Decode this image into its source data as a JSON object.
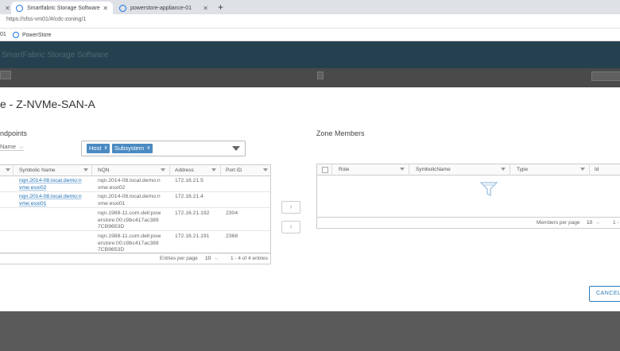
{
  "browser": {
    "tabs": [
      {
        "label": "Smartfabric Storage Software"
      },
      {
        "label": "powerstore-appliance-01"
      }
    ],
    "url": "https://sfss-vm01/#/cdc-zoning/1",
    "bookmark_prefix": "01",
    "bookmark": "PowerStore"
  },
  "app": {
    "title": "SmartFabric Storage Software"
  },
  "modal": {
    "title": "e - Z-NVMe-SAN-A",
    "endpoints_label": "ndpoints",
    "filter_name": "Name",
    "filter_chips": [
      "Host",
      "Subsystem"
    ],
    "zone_members_label": "Zone Members",
    "cancel_label": "CANCEL"
  },
  "endpoints_table": {
    "columns": [
      "Symbolic Name",
      "NQN",
      "Address",
      "Port ID"
    ],
    "rows": [
      {
        "symbolic_name": "nqn.2014-08.local.demo:n vme:esxi02",
        "nqn": "nqn.2014-08.local.demo:n vme:esxi02",
        "address": "172.16.21.5",
        "port_id": ""
      },
      {
        "symbolic_name": "nqn.2014-08.local.demo:n vme:esxi01",
        "nqn": "nqn.2014-08.local.demo:n vme:esxi01",
        "address": "172.16.21.4",
        "port_id": ""
      },
      {
        "symbolic_name": "",
        "nqn": "nqn.1988-11.com.dell:pow erstore:00:c9bc417ac389 7CB9653D",
        "address": "172.16.21.192",
        "port_id": "2304"
      },
      {
        "symbolic_name": "",
        "nqn": "nqn.1988-11.com.dell:pow erstore:00:c9bc417ac389 7CB9653D",
        "address": "172.16.21.191",
        "port_id": "2368"
      }
    ],
    "footer": {
      "entries_per_page_label": "Entries per page",
      "per_page": "10",
      "range": "1 - 4 of 4 entries"
    }
  },
  "zone_members_table": {
    "columns": [
      "Role",
      "SymbolicName",
      "Type",
      "Id"
    ],
    "footer": {
      "members_per_page_label": "Members per page",
      "per_page": "10",
      "range": "1 -"
    }
  },
  "icons": {
    "transfer_right": "chevron-right-icon",
    "transfer_left": "chevron-left-icon",
    "empty_state": "funnel-icon"
  },
  "colors": {
    "accent": "#2e7cb8",
    "chip": "#4a8ac2",
    "header": "#25414f"
  }
}
